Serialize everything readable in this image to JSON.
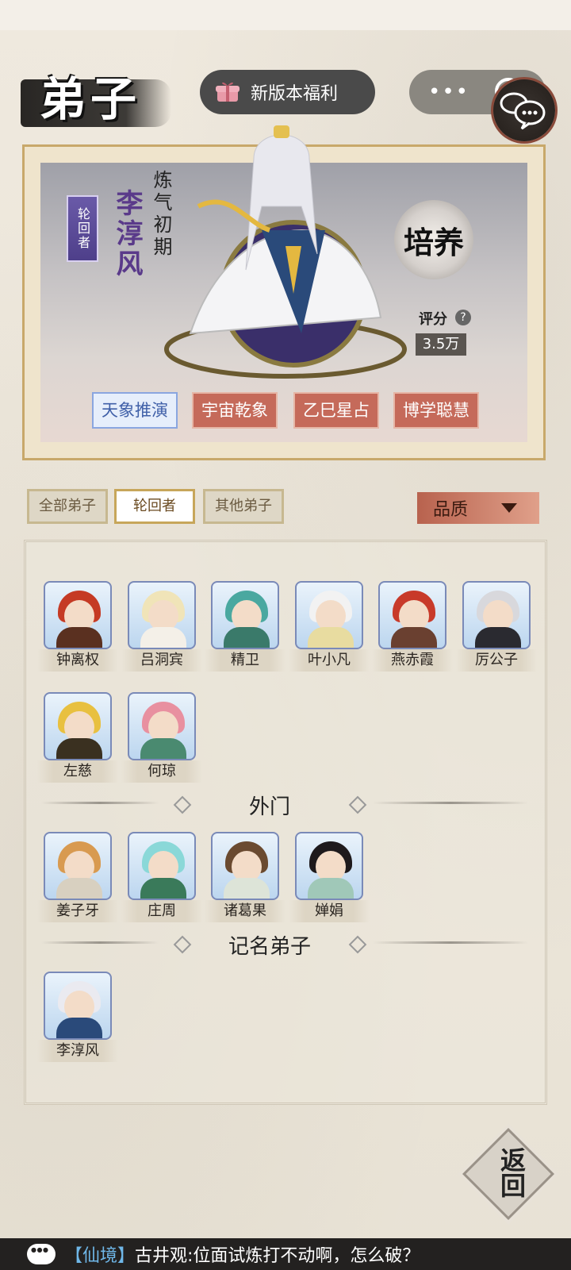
{
  "header": {
    "title": "弟子",
    "update_button": "新版本福利",
    "capsule_menu": "•••"
  },
  "hero": {
    "rank_badge": "轮回者",
    "name": "李淳风",
    "stage": "炼气初期",
    "cultivate_label": "培养",
    "score_label": "评分",
    "help_symbol": "?",
    "score_value": "3.5万",
    "skills": [
      "天象推演",
      "宇宙乾象",
      "乙巳星占",
      "博学聪慧"
    ]
  },
  "filters": {
    "tabs": [
      "全部弟子",
      "轮回者",
      "其他弟子"
    ],
    "selected": "轮回者",
    "sort_label": "品质"
  },
  "sections": [
    {
      "title": "",
      "members": [
        "钟离权",
        "吕洞宾",
        "精卫",
        "叶小凡",
        "燕赤霞",
        "厉公子",
        "左慈",
        "何琼"
      ]
    },
    {
      "title": "外门",
      "members": [
        "姜子牙",
        "庄周",
        "诸葛果",
        "婵娟"
      ]
    },
    {
      "title": "记名弟子",
      "members": [
        "李淳风"
      ]
    }
  ],
  "back_button": "返回",
  "ticker": {
    "channel": "【仙境】",
    "message": "古井观:位面试炼打不动啊，怎么破？"
  },
  "colors": {
    "accent_red": "#c56a5a",
    "skill_active": "#4060a8",
    "portrait_border": "#7a8ab8",
    "frame_gold": "#c8a86a"
  }
}
